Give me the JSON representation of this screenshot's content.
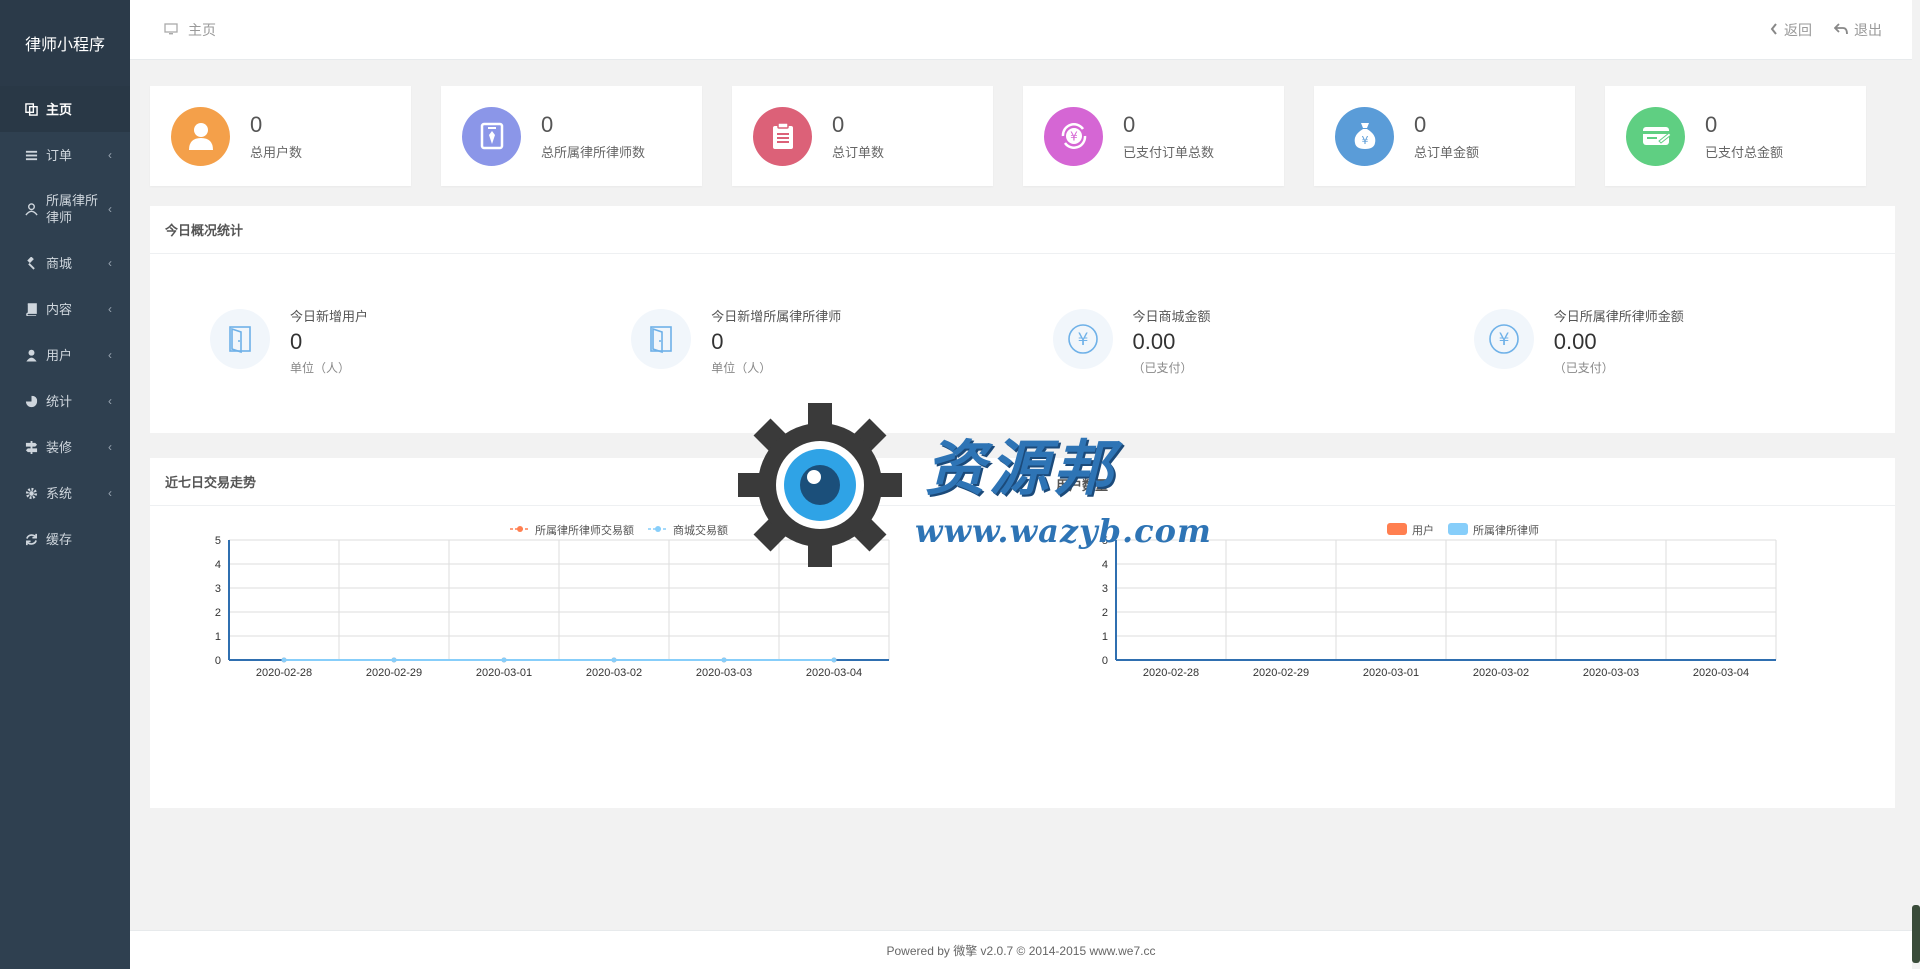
{
  "app": {
    "title": "律师小程序"
  },
  "sidebar": {
    "items": [
      {
        "label": "主页",
        "icon": "copy-icon",
        "active": true
      },
      {
        "label": "订单",
        "icon": "list-icon"
      },
      {
        "label": "所属律所律师",
        "icon": "user-outline-icon"
      },
      {
        "label": "商城",
        "icon": "gavel-icon"
      },
      {
        "label": "内容",
        "icon": "book-icon"
      },
      {
        "label": "用户",
        "icon": "user-icon"
      },
      {
        "label": "统计",
        "icon": "pie-chart-icon"
      },
      {
        "label": "装修",
        "icon": "signpost-icon"
      },
      {
        "label": "系统",
        "icon": "gear-icon"
      },
      {
        "label": "缓存",
        "icon": "refresh-icon"
      }
    ]
  },
  "header": {
    "breadcrumb": "主页",
    "back_label": "返回",
    "logout_label": "退出"
  },
  "stats": [
    {
      "value": "0",
      "label": "总用户数",
      "color": "#f4a04a",
      "icon": "user-icon"
    },
    {
      "value": "0",
      "label": "总所属律所律师数",
      "color": "#8b96e8",
      "icon": "id-badge-icon"
    },
    {
      "value": "0",
      "label": "总订单数",
      "color": "#dc6178",
      "icon": "clipboard-icon"
    },
    {
      "value": "0",
      "label": "已支付订单总数",
      "color": "#d566d4",
      "icon": "yen-refresh-icon"
    },
    {
      "value": "0",
      "label": "总订单金额",
      "color": "#5a9cd8",
      "icon": "money-bag-icon"
    },
    {
      "value": "0",
      "label": "已支付总金额",
      "color": "#5fcf82",
      "icon": "wallet-icon"
    }
  ],
  "today": {
    "title": "今日概况统计",
    "items": [
      {
        "label": "今日新增用户",
        "value": "0",
        "unit": "单位（人）",
        "icon": "door-icon"
      },
      {
        "label": "今日新增所属律所律师",
        "value": "0",
        "unit": "单位（人）",
        "icon": "door-icon"
      },
      {
        "label": "今日商城金额",
        "value": "0.00",
        "unit": "（已支付）",
        "icon": "yen-circle-icon"
      },
      {
        "label": "今日所属律所律师金额",
        "value": "0.00",
        "unit": "（已支付）",
        "icon": "yen-circle-icon"
      }
    ]
  },
  "trend": {
    "title": "近七日交易走势",
    "right_title": "用户数量"
  },
  "chart_data": [
    {
      "type": "line",
      "categories": [
        "2020-02-28",
        "2020-02-29",
        "2020-03-01",
        "2020-03-02",
        "2020-03-03",
        "2020-03-04"
      ],
      "series": [
        {
          "name": "所属律所律师交易额",
          "values": [
            0,
            0,
            0,
            0,
            0,
            0
          ],
          "color": "#ff7f50"
        },
        {
          "name": "商城交易额",
          "values": [
            0,
            0,
            0,
            0,
            0,
            0
          ],
          "color": "#87cefa"
        }
      ],
      "ylim": [
        0,
        5
      ],
      "yticks": [
        "0",
        "1",
        "2",
        "3",
        "4",
        "5"
      ],
      "grid": true,
      "legend": "top-center"
    },
    {
      "type": "bar",
      "categories": [
        "2020-02-28",
        "2020-02-29",
        "2020-03-01",
        "2020-03-02",
        "2020-03-03",
        "2020-03-04"
      ],
      "series": [
        {
          "name": "用户",
          "values": [
            0,
            0,
            0,
            0,
            0,
            0
          ],
          "color": "#ff7f50"
        },
        {
          "name": "所属律所律师",
          "values": [
            0,
            0,
            0,
            0,
            0,
            0
          ],
          "color": "#87cefa"
        }
      ],
      "ylim": [
        0,
        5
      ],
      "yticks": [
        "0",
        "1",
        "2",
        "3",
        "4",
        "5"
      ],
      "grid": true,
      "legend": "top-center"
    }
  ],
  "watermark": {
    "name": "资源邦",
    "url": "www.wazyb.com"
  },
  "footer": {
    "text": "Powered by 微擎 v2.0.7 © 2014-2015 www.we7.cc"
  }
}
